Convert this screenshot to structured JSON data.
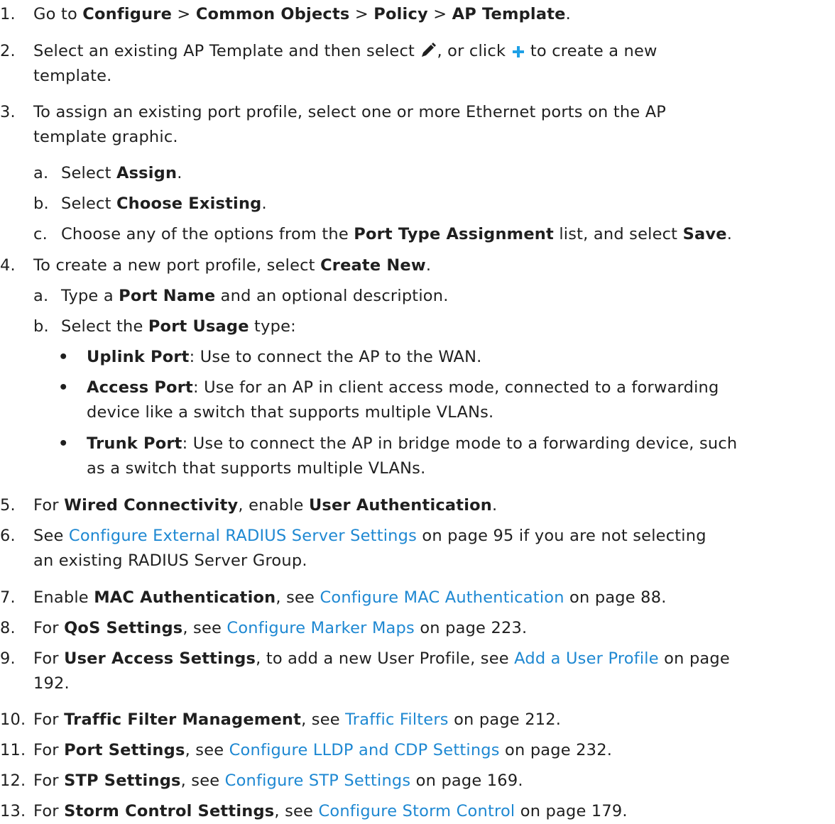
{
  "steps": [
    {
      "num": "1.",
      "parts": [
        {
          "t": "Go to "
        },
        {
          "t": "Configure",
          "b": true
        },
        {
          "t": " > "
        },
        {
          "t": "Common Objects",
          "b": true
        },
        {
          "t": " > "
        },
        {
          "t": "Policy",
          "b": true
        },
        {
          "t": " > "
        },
        {
          "t": "AP Template",
          "b": true
        },
        {
          "t": "."
        }
      ]
    },
    {
      "num": "2.",
      "a": "Select an existing AP Template and then select ",
      "b": ", or click ",
      "c": " to create a new",
      "d": "template.",
      "icons": {
        "edit": "pencil-icon",
        "add": "plus-icon"
      }
    },
    {
      "num": "3.",
      "line1": "To assign an existing port profile, select one or more Ethernet ports on the AP",
      "line2": "template graphic.",
      "subs": [
        {
          "letter": "a.",
          "parts": [
            {
              "t": "Select "
            },
            {
              "t": "Assign",
              "b": true
            },
            {
              "t": "."
            }
          ]
        },
        {
          "letter": "b.",
          "parts": [
            {
              "t": "Select "
            },
            {
              "t": "Choose Existing",
              "b": true
            },
            {
              "t": "."
            }
          ]
        },
        {
          "letter": "c.",
          "parts": [
            {
              "t": "Choose any of the options from the "
            },
            {
              "t": "Port Type Assignment",
              "b": true
            },
            {
              "t": " list, and select "
            },
            {
              "t": "Save",
              "b": true
            },
            {
              "t": "."
            }
          ]
        }
      ]
    },
    {
      "num": "4.",
      "parts": [
        {
          "t": "To create a new port profile, select "
        },
        {
          "t": "Create New",
          "b": true
        },
        {
          "t": "."
        }
      ],
      "subs": [
        {
          "letter": "a.",
          "parts": [
            {
              "t": "Type a "
            },
            {
              "t": "Port Name",
              "b": true
            },
            {
              "t": " and an optional description."
            }
          ]
        },
        {
          "letter": "b.",
          "parts": [
            {
              "t": "Select the "
            },
            {
              "t": "Port Usage",
              "b": true
            },
            {
              "t": " type:"
            }
          ]
        }
      ],
      "bullets": [
        {
          "bullet": "•",
          "label": "Uplink Port",
          "text": ": Use to connect the AP to the WAN."
        },
        {
          "bullet": "•",
          "label": "Access Port",
          "text": ": Use for an AP in client access mode, connected to a forwarding",
          "cont": "device like a switch that supports multiple VLANs."
        },
        {
          "bullet": "•",
          "label": "Trunk Port",
          "text": ": Use to connect the AP in bridge mode to a forwarding device, such",
          "cont": "as a switch that supports multiple VLANs."
        }
      ]
    },
    {
      "num": "5.",
      "parts": [
        {
          "t": "For "
        },
        {
          "t": "Wired Connectivity",
          "b": true
        },
        {
          "t": ", enable "
        },
        {
          "t": "User Authentication",
          "b": true
        },
        {
          "t": "."
        }
      ]
    },
    {
      "num": "6.",
      "parts": [
        {
          "t": "See "
        },
        {
          "t": "Configure External RADIUS Server Settings",
          "link": true
        },
        {
          "t": " on page 95 if you are not selecting"
        }
      ],
      "cont": "an existing RADIUS Server Group."
    },
    {
      "num": "7.",
      "parts": [
        {
          "t": "Enable "
        },
        {
          "t": "MAC Authentication",
          "b": true
        },
        {
          "t": ", see "
        },
        {
          "t": "Configure MAC Authentication",
          "link": true
        },
        {
          "t": " on page 88."
        }
      ]
    },
    {
      "num": "8.",
      "parts": [
        {
          "t": "For "
        },
        {
          "t": "QoS Settings",
          "b": true
        },
        {
          "t": ", see "
        },
        {
          "t": "Configure Marker Maps",
          "link": true
        },
        {
          "t": " on page 223."
        }
      ]
    },
    {
      "num": "9.",
      "parts": [
        {
          "t": "For "
        },
        {
          "t": "User Access Settings",
          "b": true
        },
        {
          "t": ", to add a new User Profile, see "
        },
        {
          "t": "Add a User Profile",
          "link": true
        },
        {
          "t": " on page"
        }
      ],
      "cont": "192."
    },
    {
      "num": "10.",
      "parts": [
        {
          "t": "For "
        },
        {
          "t": "Traffic Filter Management",
          "b": true
        },
        {
          "t": ", see "
        },
        {
          "t": "Traffic Filters",
          "link": true
        },
        {
          "t": " on page 212."
        }
      ]
    },
    {
      "num": "11.",
      "parts": [
        {
          "t": "For "
        },
        {
          "t": "Port Settings",
          "b": true
        },
        {
          "t": ", see "
        },
        {
          "t": "Configure LLDP and CDP Settings",
          "link": true
        },
        {
          "t": " on page 232."
        }
      ]
    },
    {
      "num": "12.",
      "parts": [
        {
          "t": "For "
        },
        {
          "t": "STP Settings",
          "b": true
        },
        {
          "t": ", see "
        },
        {
          "t": "Configure STP Settings",
          "link": true
        },
        {
          "t": " on page 169."
        }
      ]
    },
    {
      "num": "13.",
      "parts": [
        {
          "t": "For "
        },
        {
          "t": "Storm Control Settings",
          "b": true
        },
        {
          "t": ", see "
        },
        {
          "t": "Configure Storm Control",
          "link": true
        },
        {
          "t": " on page 179."
        }
      ]
    }
  ]
}
